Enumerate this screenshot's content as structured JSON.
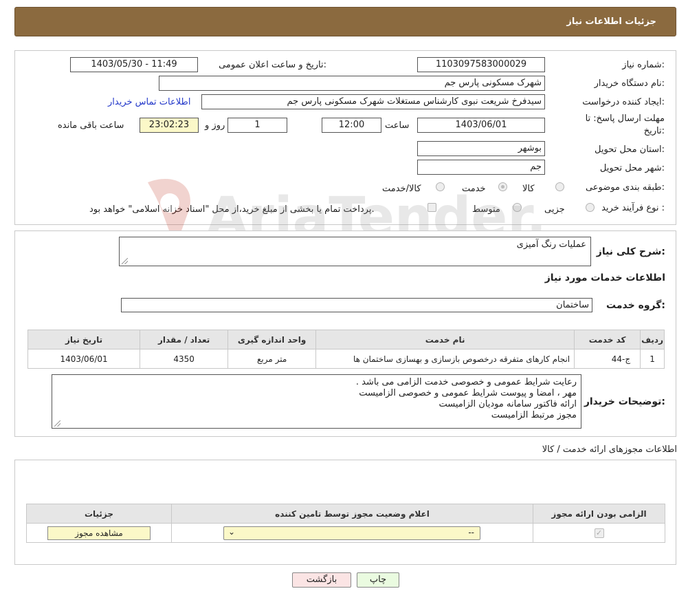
{
  "header": {
    "title": "جزئیات اطلاعات نیاز"
  },
  "form": {
    "need_number_label": "شماره نیاز:",
    "need_number": "1103097583000029",
    "announce_label": "تاریخ و ساعت اعلان عمومی:",
    "announce_value": "1403/05/30 - 11:49",
    "buyer_org_label": "نام دستگاه خریدار:",
    "buyer_org": "شهرک مسکونی پارس جم",
    "creator_label": "ایجاد کننده درخواست:",
    "creator": "سیدفرخ شریعت نبوی کارشناس مستغلات شهرک مسکونی پارس جم",
    "contact_link": "اطلاعات تماس خریدار",
    "deadline_label_1": "مهلت ارسال پاسخ: تا",
    "deadline_label_2": "تاریخ:",
    "deadline_date": "1403/06/01",
    "time_label": "ساعت",
    "deadline_time": "12:00",
    "days_value": "1",
    "days_label": "روز و",
    "remaining_time": "23:02:23",
    "remaining_label": "ساعت باقی مانده",
    "province_label": "استان محل تحویل:",
    "province": "بوشهر",
    "city_label": "شهر محل تحویل:",
    "city": "جم",
    "category_label": "طبقه بندی موضوعی:",
    "category_options": [
      "کالا",
      "خدمت",
      "کالا/خدمت"
    ],
    "category_selected": "خدمت",
    "process_label": "نوع فرآیند خرید :",
    "process_options": [
      "جزیی",
      "متوسط"
    ],
    "payment_note": "پرداخت تمام یا بخشی از مبلغ خرید،از محل \"اسناد خزانه اسلامی\" خواهد بود."
  },
  "details": {
    "summary_label": "شرح کلی نیاز:",
    "summary_value": "عملیات رنگ آمیزی",
    "services_title": "اطلاعات خدمات مورد نیاز",
    "service_group_label": "گروه خدمت:",
    "service_group_value": "ساختمان",
    "table": {
      "headers": [
        "ردیف",
        "کد خدمت",
        "نام خدمت",
        "واحد اندازه گیری",
        "تعداد / مقدار",
        "تاریخ نیاز"
      ],
      "rows": [
        [
          "1",
          "ج-44",
          "انجام کارهای متفرقه درخصوص بازسازی و بهسازی ساختمان ها",
          "متر مربع",
          "4350",
          "1403/06/01"
        ]
      ]
    },
    "buyer_notes_label": "توضیحات خریدار:",
    "buyer_notes": [
      "رعایت شرایط عمومی و خصوصی خدمت الزامی می باشد .",
      "مهر ، امضا و پیوست شرایط عمومی و خصوصی الزامیست",
      "ارائه فاکتور سامانه مودیان الزامیست",
      "مجوز مرتبط الزامیست"
    ]
  },
  "permits": {
    "title": "اطلاعات مجوزهای ارائه خدمت / کالا",
    "headers": [
      "الزامی بودن ارائه مجوز",
      "اعلام وضعیت مجوز توسط تامین کننده",
      "جزئیات"
    ],
    "select_value": "--",
    "view_button": "مشاهده مجوز"
  },
  "buttons": {
    "print": "چاپ",
    "back": "بازگشت"
  },
  "watermark_text": "AriaTender.neT"
}
